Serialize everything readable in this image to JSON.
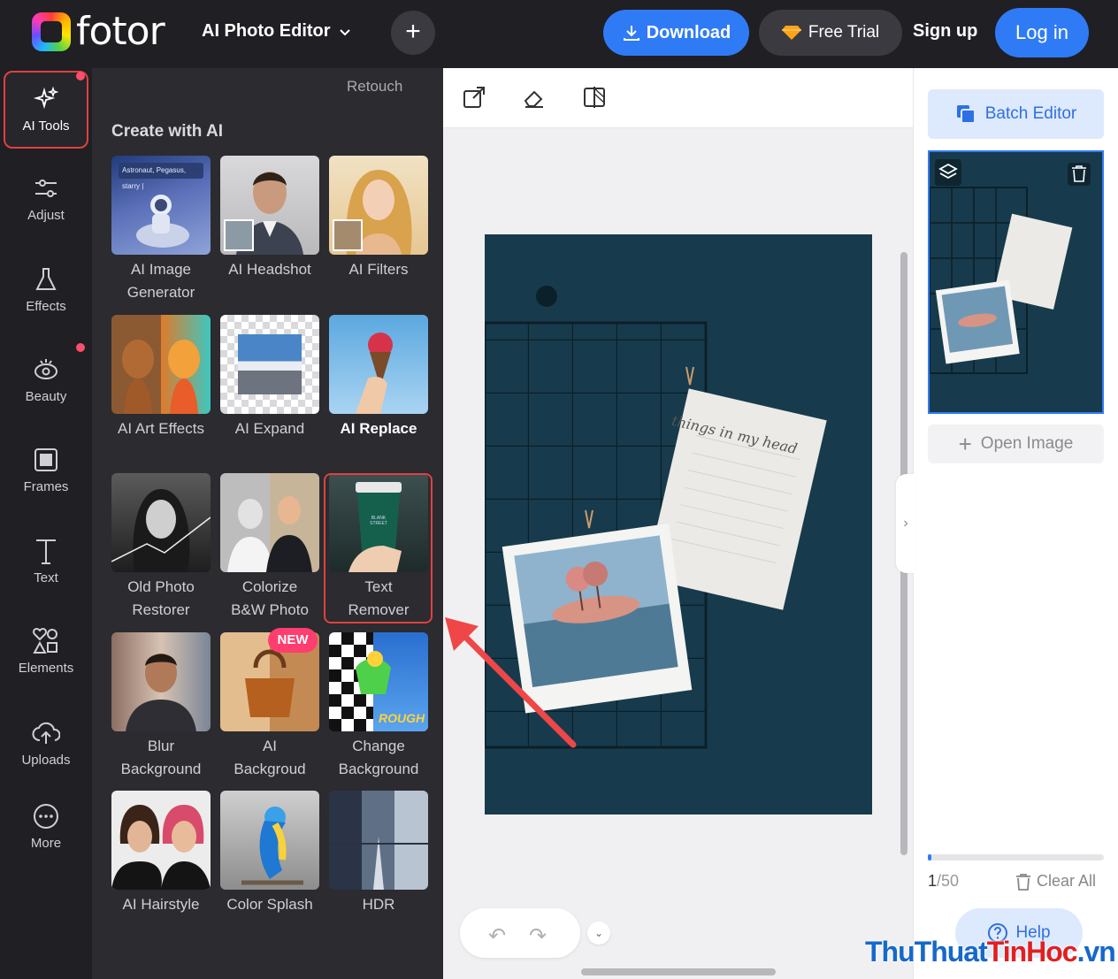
{
  "header": {
    "brand": "fotor",
    "editor_menu": "AI Photo Editor",
    "download": "Download",
    "free_trial": "Free Trial",
    "sign_up": "Sign up",
    "log_in": "Log in"
  },
  "rail": {
    "items": [
      {
        "label": "AI Tools",
        "icon": "sparkle-icon"
      },
      {
        "label": "Adjust",
        "icon": "sliders-icon"
      },
      {
        "label": "Effects",
        "icon": "flask-icon"
      },
      {
        "label": "Beauty",
        "icon": "eye-icon"
      },
      {
        "label": "Frames",
        "icon": "frame-icon"
      },
      {
        "label": "Text",
        "icon": "text-icon"
      },
      {
        "label": "Elements",
        "icon": "shapes-icon"
      },
      {
        "label": "Uploads",
        "icon": "cloud-upload-icon"
      },
      {
        "label": "More",
        "icon": "more-icon"
      }
    ]
  },
  "panel": {
    "retouch": "Retouch",
    "section_title": "Create with AI",
    "new_badge": "NEW",
    "tools": [
      {
        "l1": "AI Image",
        "l2": "Generator",
        "caption": "Astronaut, Pegasus, starry |"
      },
      {
        "l1": "AI Headshot",
        "l2": ""
      },
      {
        "l1": "AI Filters",
        "l2": ""
      },
      {
        "l1": "AI Art Effects",
        "l2": ""
      },
      {
        "l1": "AI Expand",
        "l2": ""
      },
      {
        "l1": "AI Replace",
        "l2": ""
      },
      {
        "l1": "Old Photo",
        "l2": "Restorer"
      },
      {
        "l1": "Colorize",
        "l2": "B&W Photo"
      },
      {
        "l1": "Text",
        "l2": "Remover",
        "cup": "BLANK STREET"
      },
      {
        "l1": "Blur",
        "l2": "Background"
      },
      {
        "l1": "AI",
        "l2": "Backgroud"
      },
      {
        "l1": "Change",
        "l2": "Background",
        "sticker": "ROUGH"
      },
      {
        "l1": "AI Hairstyle",
        "l2": ""
      },
      {
        "l1": "Color Splash",
        "l2": ""
      },
      {
        "l1": "HDR",
        "l2": ""
      }
    ]
  },
  "canvas": {
    "note_text": "things in my head"
  },
  "right_panel": {
    "batch_editor": "Batch Editor",
    "open_image": "Open Image",
    "count_current": "1",
    "count_total": "/50",
    "progress": 0.02,
    "clear_all": "Clear All",
    "help": "Help"
  },
  "watermark": {
    "part1": "ThuThuat",
    "part2": "TinHoc",
    "part3": ".vn"
  },
  "colors": {
    "accent": "#2f7bf5",
    "highlight": "#e0413f",
    "dark_bg": "#1f1f24",
    "panel_bg": "#2b2b30",
    "photo_bg": "#173b4c"
  }
}
